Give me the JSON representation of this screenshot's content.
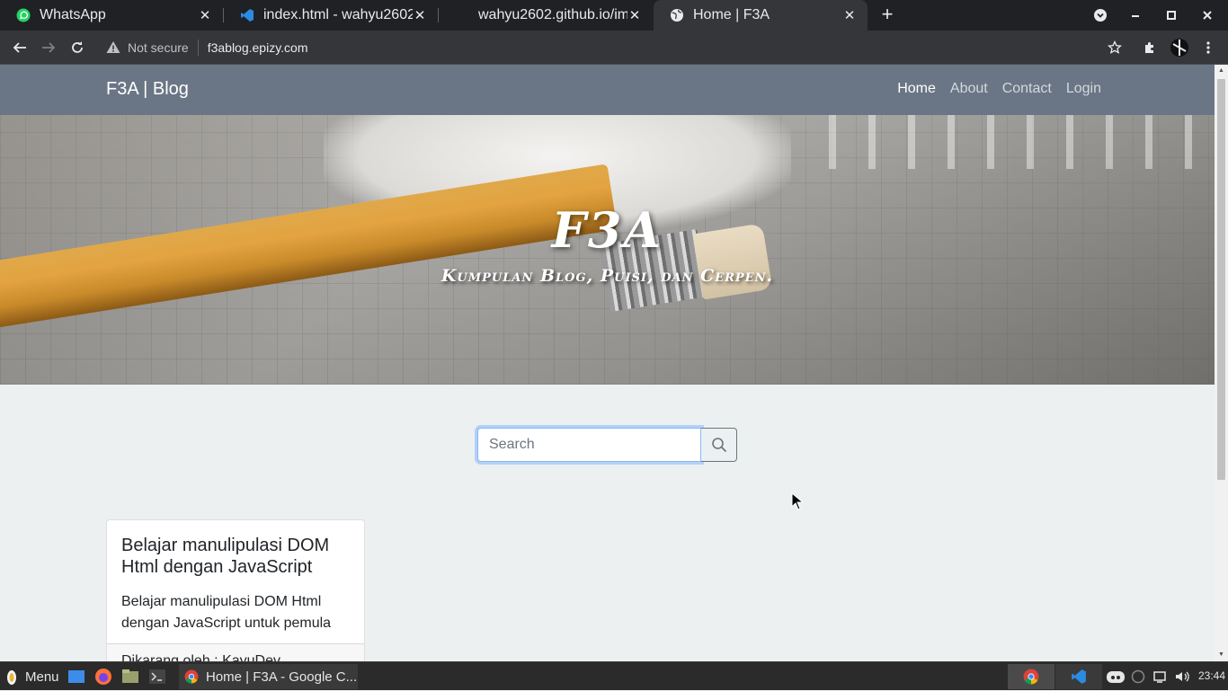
{
  "browser": {
    "tabs": [
      {
        "title": "WhatsApp",
        "icon": "whatsapp-icon"
      },
      {
        "title": "index.html - wahyu2602.",
        "icon": "vscode-icon"
      },
      {
        "title": "wahyu2602.github.io/im",
        "icon": "blank-page-icon"
      },
      {
        "title": "Home | F3A",
        "icon": "globe-icon",
        "active": true
      }
    ],
    "security_label": "Not secure",
    "url": "f3ablog.epizy.com"
  },
  "site": {
    "brand": "F3A | Blog",
    "nav": [
      "Home",
      "About",
      "Contact",
      "Login"
    ],
    "hero_title": "F3A",
    "hero_subtitle": "Kumpulan Blog, Puisi, dan Cerpen.",
    "search": {
      "placeholder": "Search",
      "value": ""
    },
    "posts": [
      {
        "title": "Belajar manulipulasi DOM Html dengan JavaScript",
        "excerpt": "Belajar manulipulasi DOM Html dengan JavaScript untuk pemula",
        "footer": "Dikarang oleh : KayuDev"
      }
    ]
  },
  "taskbar": {
    "menu_label": "Menu",
    "active_app": "Home | F3A - Google C...",
    "clock": "23:44"
  },
  "colors": {
    "navbar": "#6a7685",
    "page_bg": "#ecf0f1",
    "chrome_dark": "#202124",
    "chrome_toolbar": "#35363a"
  }
}
